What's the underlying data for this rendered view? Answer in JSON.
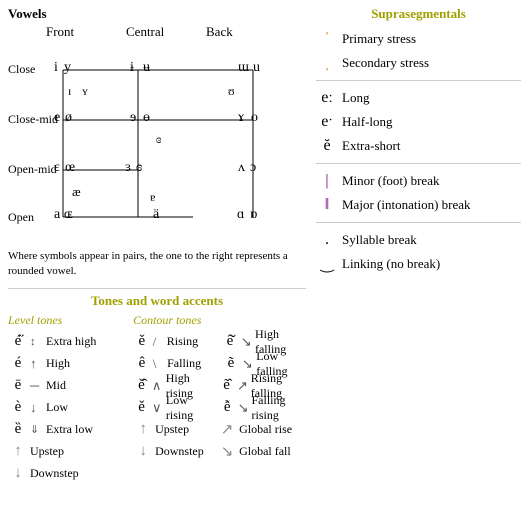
{
  "left": {
    "vowels": {
      "title": "Vowels",
      "columns": [
        "Front",
        "Central",
        "Back"
      ],
      "rows": [
        {
          "label": "Close",
          "symbols": "i y — ɨ ʉ — ɯ u"
        },
        {
          "label": "",
          "symbols": "ɪ ʏ       ʊ"
        },
        {
          "label": "Close-mid",
          "symbols": "e ø — ɘ ɵ — ɤ o"
        },
        {
          "label": "",
          "symbols": "           ɞ"
        },
        {
          "label": "Open-mid",
          "symbols": "ɛ œ — ɜ ɞ — ʌ ɔ"
        },
        {
          "label": "",
          "symbols": "        æ        ɐ"
        },
        {
          "label": "Open",
          "symbols": "a ɶ ——— ä   ɑ ɒ"
        }
      ],
      "note": "Where symbols appear in pairs, the one to the right\nrepresents a rounded vowel."
    },
    "tones": {
      "title": "Tones and word accents",
      "level_title": "Level tones",
      "contour_title": "Contour tones",
      "level": [
        {
          "symbol": "é̋",
          "icon": "↑̄",
          "label": "Extra high",
          "extra": true
        },
        {
          "symbol": "é",
          "icon": "↑",
          "label": "High"
        },
        {
          "symbol": "ē",
          "icon": "—",
          "label": "Mid"
        },
        {
          "symbol": "è",
          "icon": "↓",
          "label": "Low"
        },
        {
          "symbol": "ȅ",
          "icon": "↓↓",
          "label": "Extra low"
        }
      ],
      "contour": [
        {
          "symbol": "ě",
          "icon": "/",
          "label": "Rising"
        },
        {
          "symbol": "ê",
          "icon": "\\",
          "label": "Falling"
        },
        {
          "symbol": "ě̂",
          "icon": "/\\",
          "label": "High rising"
        },
        {
          "symbol": "ě",
          "icon": "\\/",
          "label": "Low rising"
        },
        {
          "symbol": "↑",
          "label": "Upstep"
        },
        {
          "symbol": "↓",
          "label": "Downstep"
        }
      ],
      "extra_contour": [
        {
          "symbol": "ê̌",
          "icon": "↘",
          "label": "High falling"
        },
        {
          "symbol": "ẽ̀",
          "icon": "↘",
          "label": "Low falling"
        },
        {
          "symbol": "ě̂",
          "icon": "↗",
          "label": "Rising falling"
        },
        {
          "symbol": "ễ",
          "icon": "↘",
          "label": "Falling rising"
        },
        {
          "symbol": "↗",
          "label": "Global rise"
        },
        {
          "symbol": "↘",
          "label": "Global fall"
        }
      ]
    }
  },
  "right": {
    "title": "Suprasegmentals",
    "items": [
      {
        "symbol": "|",
        "label": "Primary stress",
        "color": "orange"
      },
      {
        "symbol": "|",
        "label": "Secondary stress",
        "color": "orange"
      },
      {
        "symbol": "eː",
        "label": "Long",
        "color": "black"
      },
      {
        "symbol": "eˑ",
        "label": "Half-long",
        "color": "black"
      },
      {
        "symbol": "ĕ",
        "label": "Extra-short",
        "color": "black"
      },
      {
        "symbol": "|",
        "label": "Minor (foot) break",
        "color": "purple"
      },
      {
        "symbol": "‖",
        "label": "Major (intonation) break",
        "color": "purple"
      },
      {
        "symbol": ".",
        "label": "Syllable break",
        "color": "black"
      },
      {
        "symbol": "‿",
        "label": "Linking (no break)",
        "color": "black"
      }
    ]
  }
}
